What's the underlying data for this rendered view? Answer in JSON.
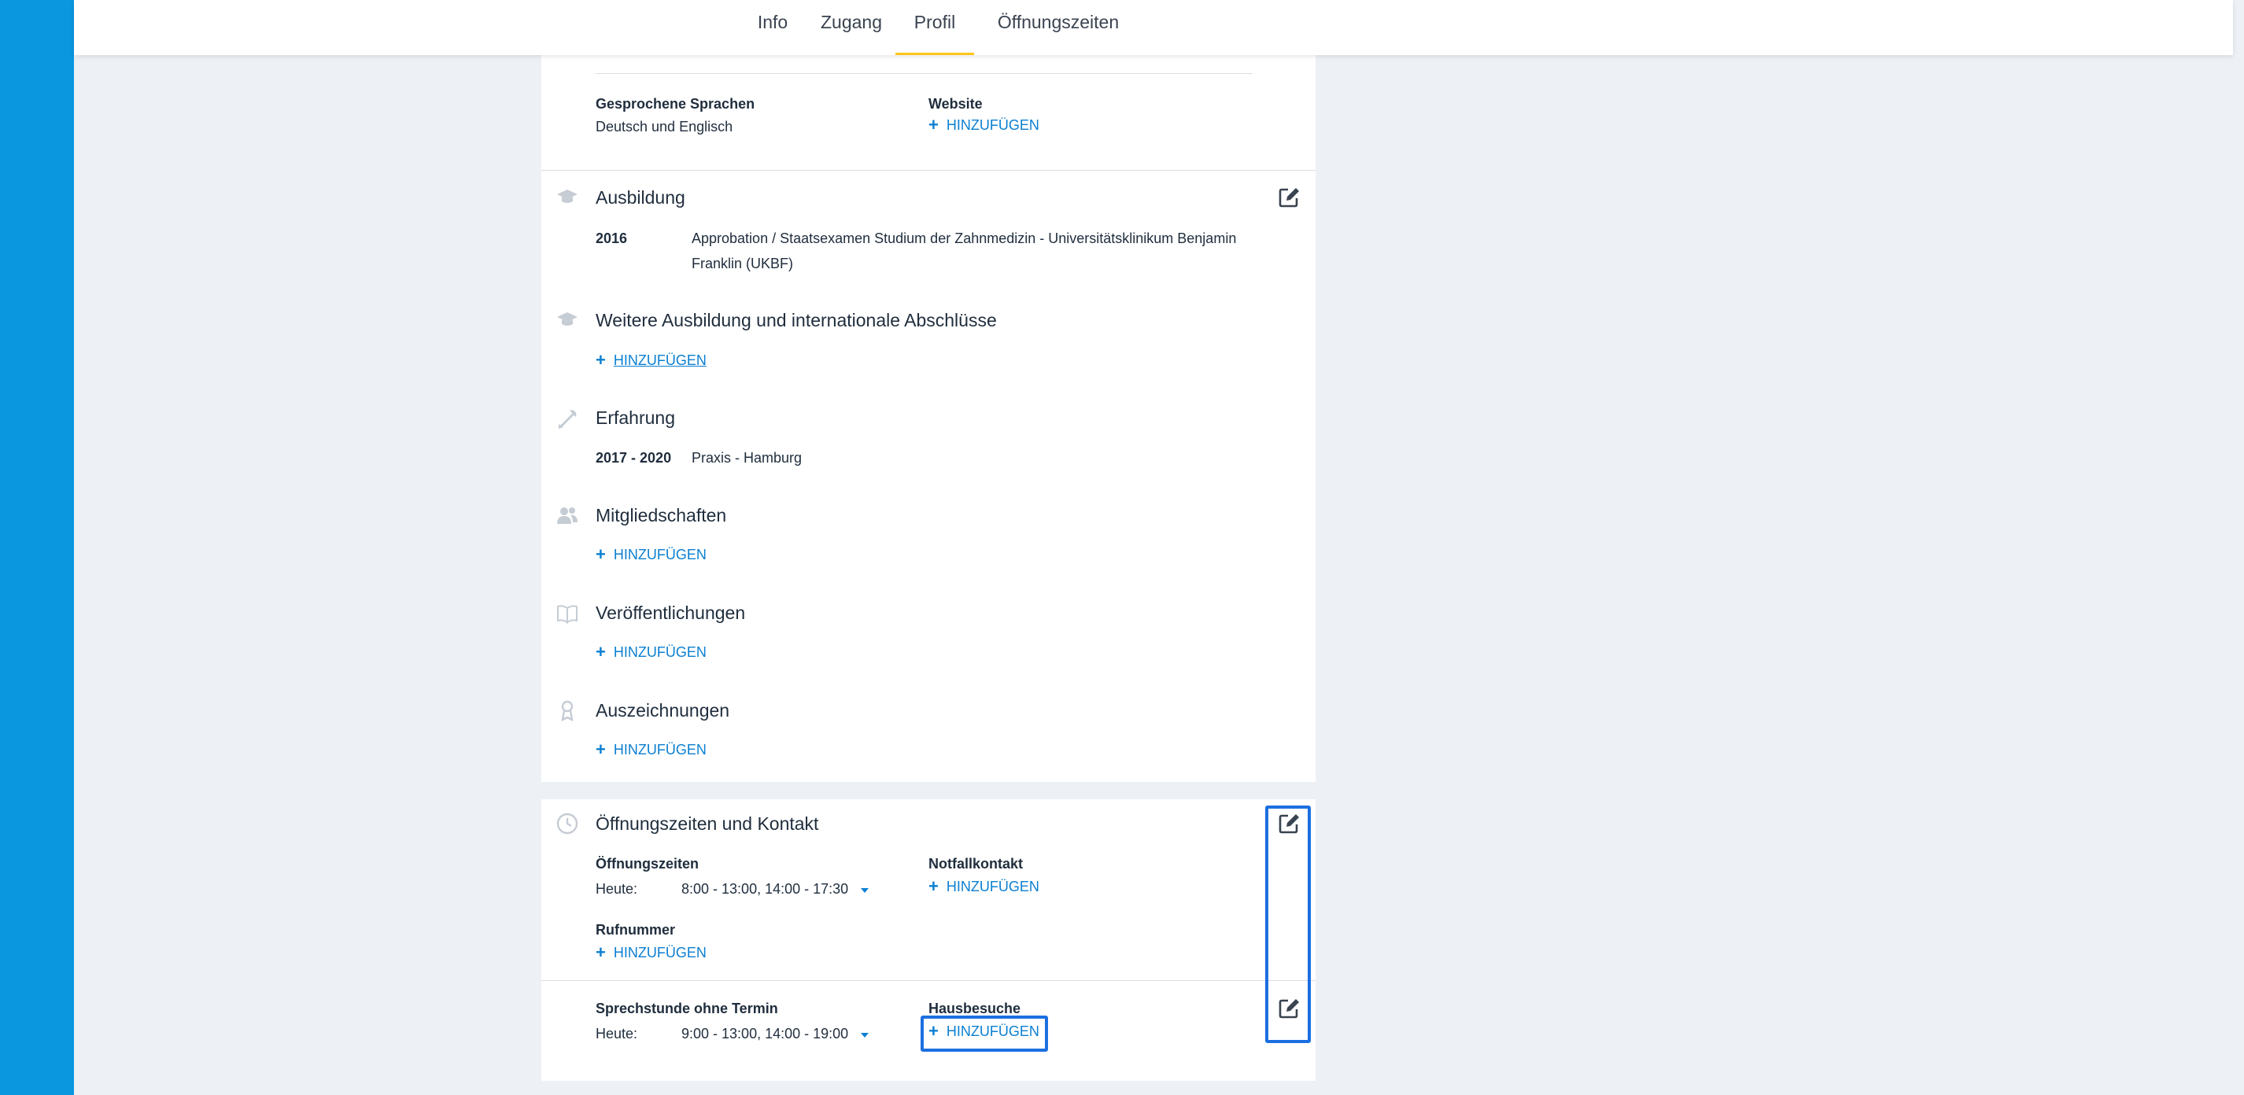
{
  "nav": {
    "tabs": [
      {
        "label": "Info"
      },
      {
        "label": "Zugang"
      },
      {
        "label": "Profil"
      },
      {
        "label": "Öffnungszeiten"
      }
    ]
  },
  "profile": {
    "languages_label": "Gesprochene Sprachen",
    "languages_value": "Deutsch und Englisch",
    "website_label": "Website",
    "add_label": "HINZUFÜGEN"
  },
  "education": {
    "title": "Ausbildung",
    "year": "2016",
    "text_line1": "Approbation / Staatsexamen Studium der Zahnmedizin - Universitätsklinikum Benjamin",
    "text_line2": "Franklin (UKBF)"
  },
  "further_education": {
    "title": "Weitere Ausbildung und internationale Abschlüsse"
  },
  "experience": {
    "title": "Erfahrung",
    "period": "2017 - 2020",
    "place": "Praxis - Hamburg"
  },
  "memberships": {
    "title": "Mitgliedschaften"
  },
  "publications": {
    "title": "Veröffentlichungen"
  },
  "awards": {
    "title": "Auszeichnungen"
  },
  "contact": {
    "title": "Öffnungszeiten und Kontakt",
    "hours_label": "Öffnungszeiten",
    "today_label": "Heute:",
    "hours_value": "8:00 - 13:00, 14:00 - 17:30",
    "emergency_label": "Notfallkontakt",
    "phone_label": "Rufnummer",
    "walkin_label": "Sprechstunde ohne Termin",
    "walkin_value": "9:00 - 13:00, 14:00 - 19:00",
    "house_calls_label": "Hausbesuche"
  },
  "colors": {
    "accent": "#0b7fd1",
    "sidebar": "#0b96e0",
    "tab_underline": "#ffc61a",
    "highlight": "#1c6fe0"
  }
}
